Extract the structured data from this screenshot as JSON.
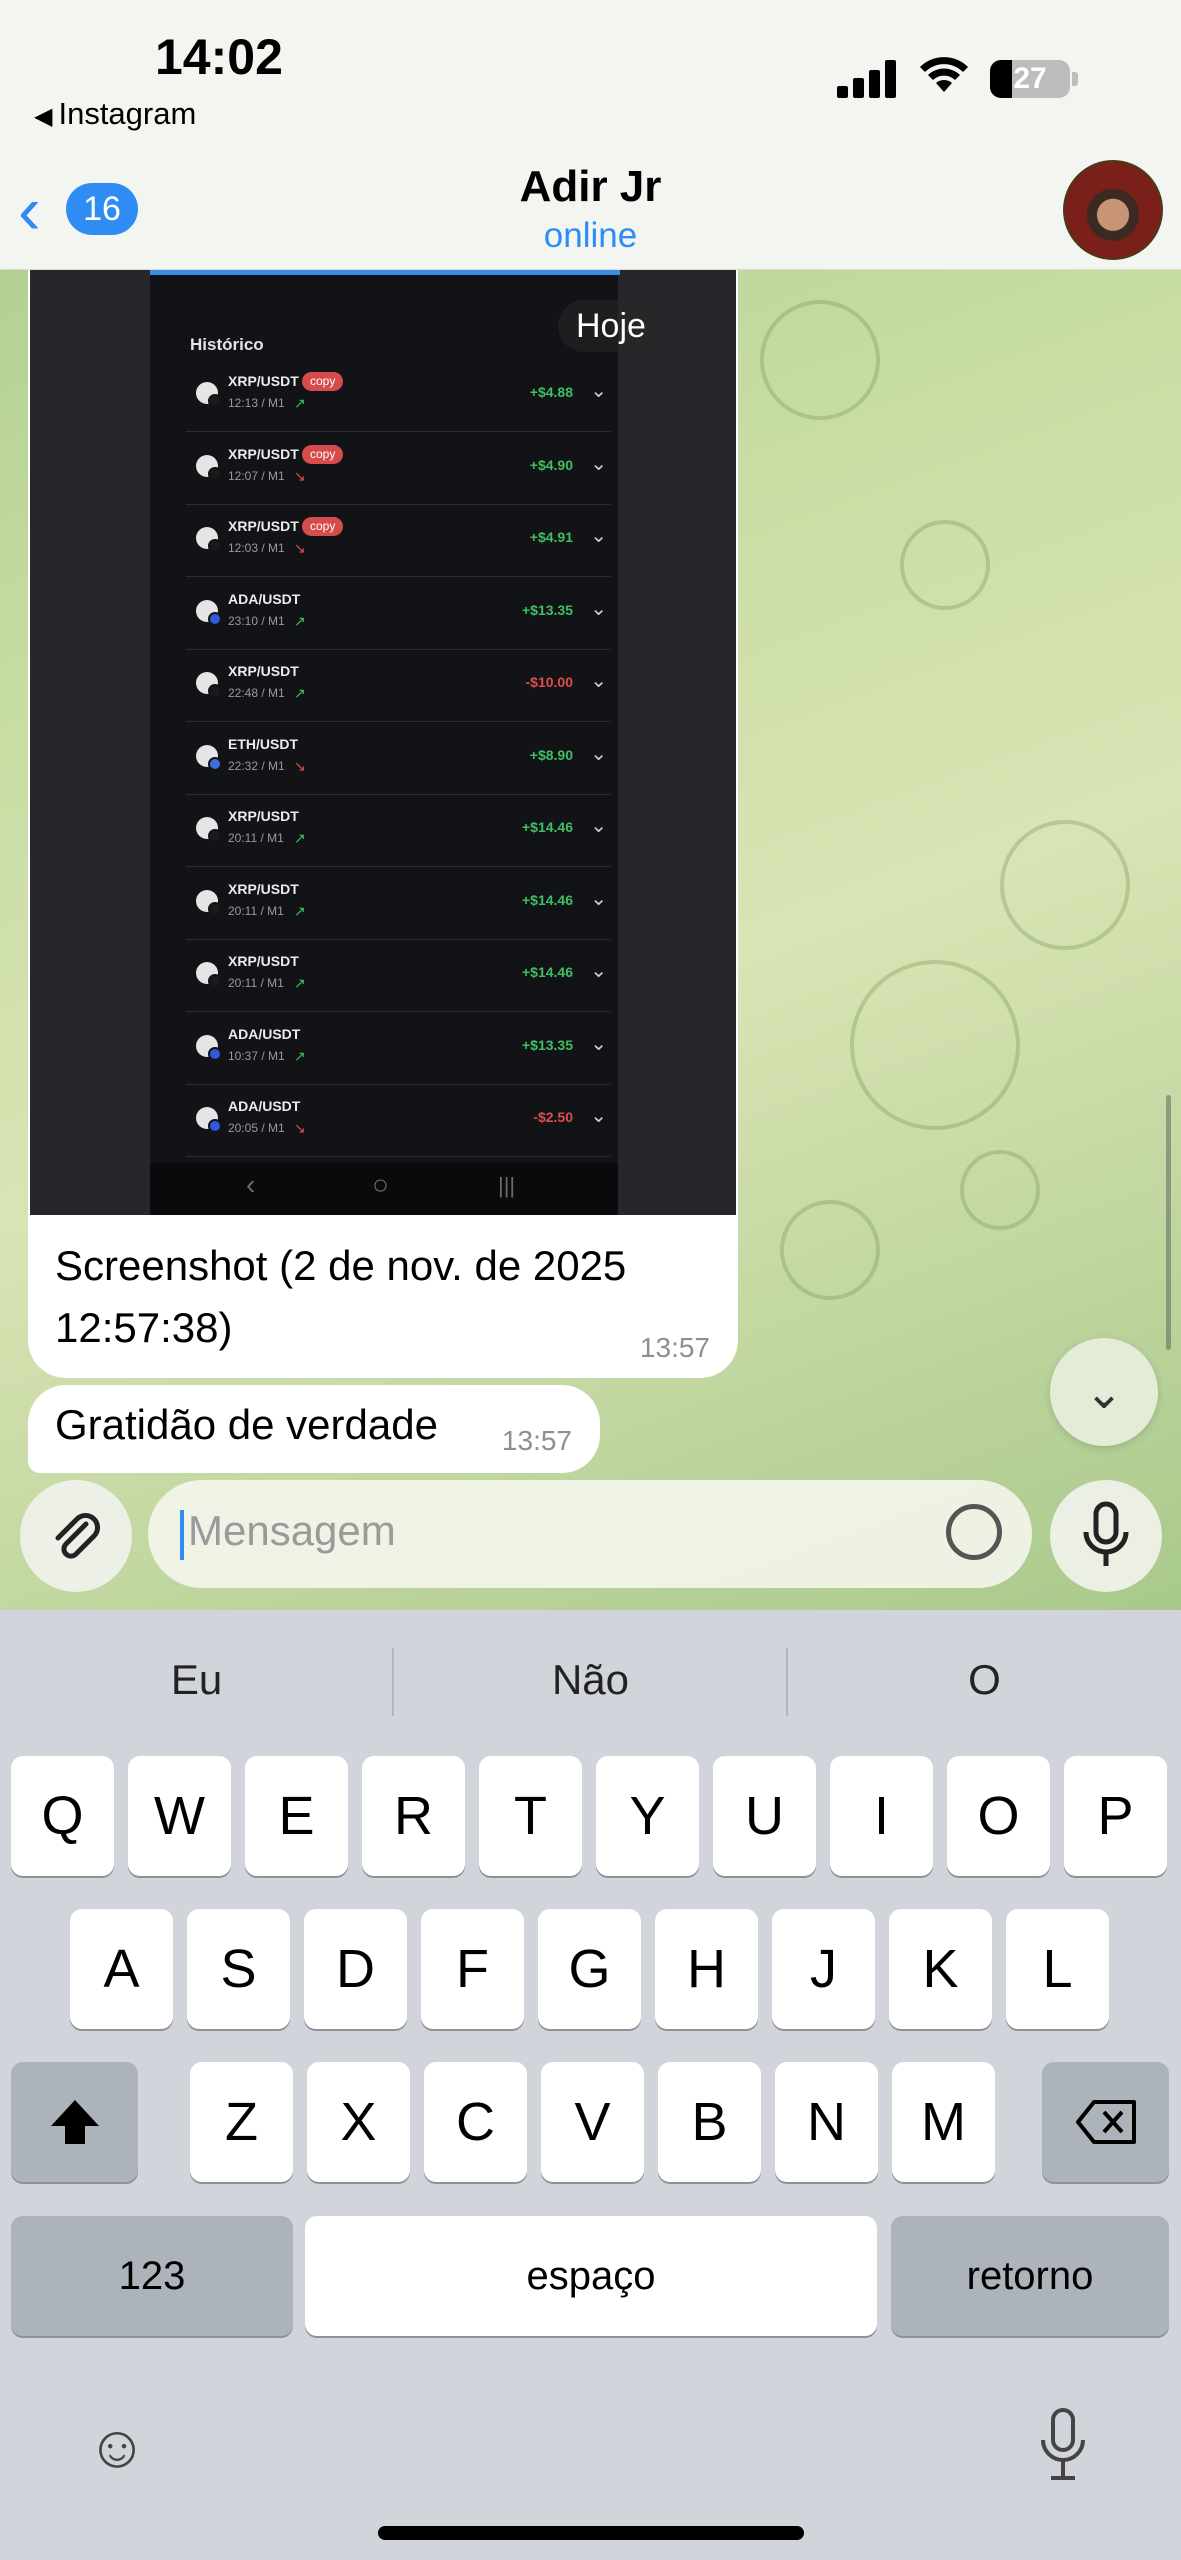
{
  "status_bar": {
    "time": "14:02",
    "back_app": "Instagram",
    "battery": "27",
    "battery_level": 0.27
  },
  "header": {
    "back_count": "16",
    "name": "Adir Jr",
    "status": "online"
  },
  "image_message": {
    "date_pill": "Hoje",
    "screen_title": "Histórico",
    "copy_label": "copy",
    "trades": [
      {
        "pair": "XRP/USDT",
        "time": "12:13 / M1",
        "amount": "+$4.88",
        "copy": true,
        "up": true
      },
      {
        "pair": "XRP/USDT",
        "time": "12:07 / M1",
        "amount": "+$4.90",
        "copy": true,
        "up": false
      },
      {
        "pair": "XRP/USDT",
        "time": "12:03 / M1",
        "amount": "+$4.91",
        "copy": true,
        "up": false
      },
      {
        "pair": "ADA/USDT",
        "time": "23:10 / M1",
        "amount": "+$13.35",
        "copy": false,
        "up": true
      },
      {
        "pair": "XRP/USDT",
        "time": "22:48 / M1",
        "amount": "-$10.00",
        "copy": false,
        "up": true
      },
      {
        "pair": "ETH/USDT",
        "time": "22:32 / M1",
        "amount": "+$8.90",
        "copy": false,
        "up": false
      },
      {
        "pair": "XRP/USDT",
        "time": "20:11 / M1",
        "amount": "+$14.46",
        "copy": false,
        "up": true
      },
      {
        "pair": "XRP/USDT",
        "time": "20:11 / M1",
        "amount": "+$14.46",
        "copy": false,
        "up": true
      },
      {
        "pair": "XRP/USDT",
        "time": "20:11 / M1",
        "amount": "+$14.46",
        "copy": false,
        "up": true
      },
      {
        "pair": "ADA/USDT",
        "time": "10:37 / M1",
        "amount": "+$13.35",
        "copy": false,
        "up": true
      },
      {
        "pair": "ADA/USDT",
        "time": "20:05 / M1",
        "amount": "-$2.50",
        "copy": false,
        "up": false
      }
    ],
    "caption": "Screenshot (2 de nov. de 2025 12:57:38)",
    "time": "13:57"
  },
  "text_message": {
    "text": "Gratidão de verdade",
    "time": "13:57"
  },
  "composer": {
    "placeholder": "Mensagem"
  },
  "keyboard": {
    "suggestions": [
      "Eu",
      "Não",
      "O"
    ],
    "row1": [
      "Q",
      "W",
      "E",
      "R",
      "T",
      "Y",
      "U",
      "I",
      "O",
      "P"
    ],
    "row2": [
      "A",
      "S",
      "D",
      "F",
      "G",
      "H",
      "J",
      "K",
      "L"
    ],
    "row3": [
      "Z",
      "X",
      "C",
      "V",
      "B",
      "N",
      "M"
    ],
    "numbers_label": "123",
    "space_label": "espaço",
    "return_label": "retorno"
  },
  "icons": {
    "back": "chevron-left-icon",
    "attach": "paperclip-icon",
    "sticker": "sticker-icon",
    "mic": "microphone-icon",
    "scroll_down": "chevron-down-icon",
    "shift": "shift-icon",
    "delete": "delete-icon",
    "emoji": "emoji-icon",
    "dictation": "dictation-icon"
  },
  "colors": {
    "accent": "#2f8cf5",
    "positive": "#3fbf62",
    "negative": "#e04b4b",
    "copy_badge": "#d64b4b"
  }
}
